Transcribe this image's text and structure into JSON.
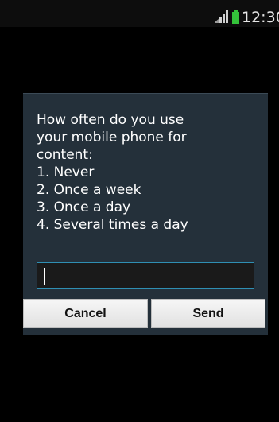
{
  "status_bar": {
    "time": "12:30",
    "icons": [
      "signal-icon",
      "battery-icon"
    ],
    "colors": {
      "battery": "#34c23a",
      "signal": "#d0d0d0"
    }
  },
  "dialog": {
    "prompt_lines": [
      "How often do you use",
      "your mobile phone for",
      "content:",
      "1. Never",
      "2. Once a week",
      "3. Once a day",
      "4. Several times a day"
    ],
    "input": {
      "value": "",
      "placeholder": ""
    },
    "buttons": {
      "cancel": "Cancel",
      "send": "Send"
    },
    "colors": {
      "background": "#24303a",
      "input_border": "#2f8fb3"
    }
  }
}
